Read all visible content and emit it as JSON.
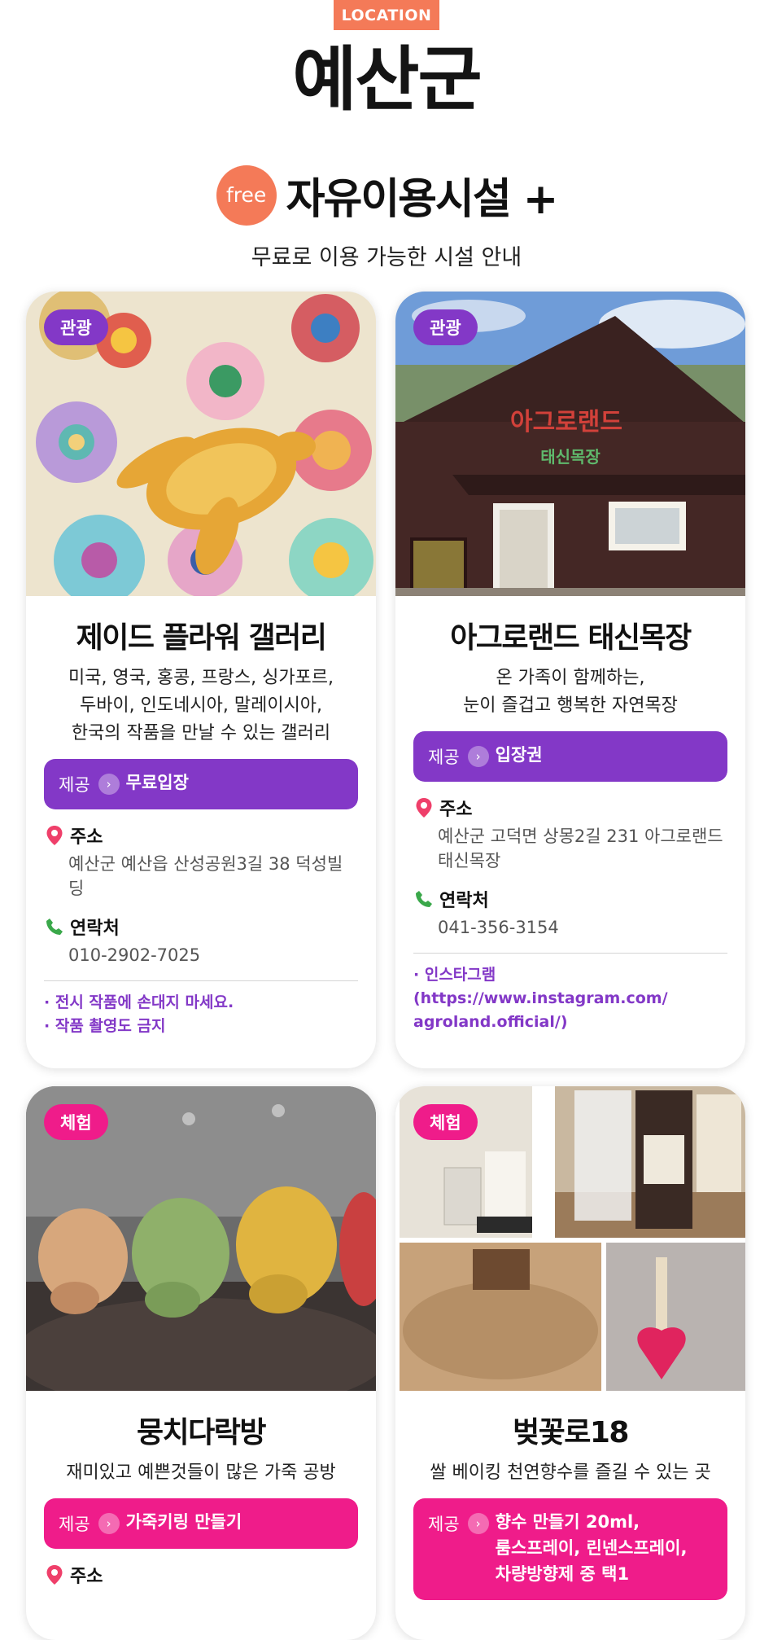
{
  "header": {
    "badge": "LOCATION",
    "region": "예산군",
    "free_badge": "free",
    "section_title": "자유이용시설 +",
    "section_subtitle": "무료로 이용 가능한 시설 안내"
  },
  "colors": {
    "orange": "#f47a58",
    "purple": "#8338c7",
    "pink": "#ef1c8a"
  },
  "cards": [
    {
      "tag": "관광",
      "name": "제이드 플라워 갤러리",
      "description": "미국, 영국, 홍콩, 프랑스, 싱가포르,\n두바이, 인도네시아, 말레이시아,\n한국의 작품을 만날 수 있는 갤러리",
      "provide_label": "제공",
      "provide_value": "무료입장",
      "address_label": "주소",
      "address": "예산군 예산읍 산성공원3길 38 덕성빌딩",
      "contact_label": "연락처",
      "contact": "010-2902-7025",
      "notes": [
        "· 전시 작품에 손대지 마세요.",
        "· 작품 촬영도 금지"
      ],
      "photo_icon": "flower-turtle-painting"
    },
    {
      "tag": "관광",
      "name": "아그로랜드 태신목장",
      "description": "온 가족이 함께하는,\n눈이 즐겁고 행복한 자연목장",
      "provide_label": "제공",
      "provide_value": "입장권",
      "address_label": "주소",
      "address": "예산군 고덕면 상몽2길 231 아그로랜드 태신목장",
      "contact_label": "연락처",
      "contact": "041-356-3154",
      "notes": [
        "· 인스타그램",
        "  (https://www.instagram.com/\n   agroland.official/)"
      ],
      "photo_icon": "farm-building",
      "sign_top": "아그로랜드",
      "sign_bottom": "태신목장"
    },
    {
      "tag": "체험",
      "name": "뭉치다락방",
      "description": "재미있고 예쁜것들이 많은 가죽 공방",
      "provide_label": "제공",
      "provide_value": "가죽키링 만들기",
      "address_label": "주소",
      "photo_icon": "leather-pig-keyrings"
    },
    {
      "tag": "체험",
      "name": "벚꽃로18",
      "description": "쌀 베이킹 천연향수를 즐길 수 있는 곳",
      "provide_label": "제공",
      "provide_value": "향수 만들기 20ml,\n룸스프레이, 린넨스프레이,\n차량방향제 중 택1",
      "photo_icon": "perfume-bottles-collage"
    }
  ]
}
